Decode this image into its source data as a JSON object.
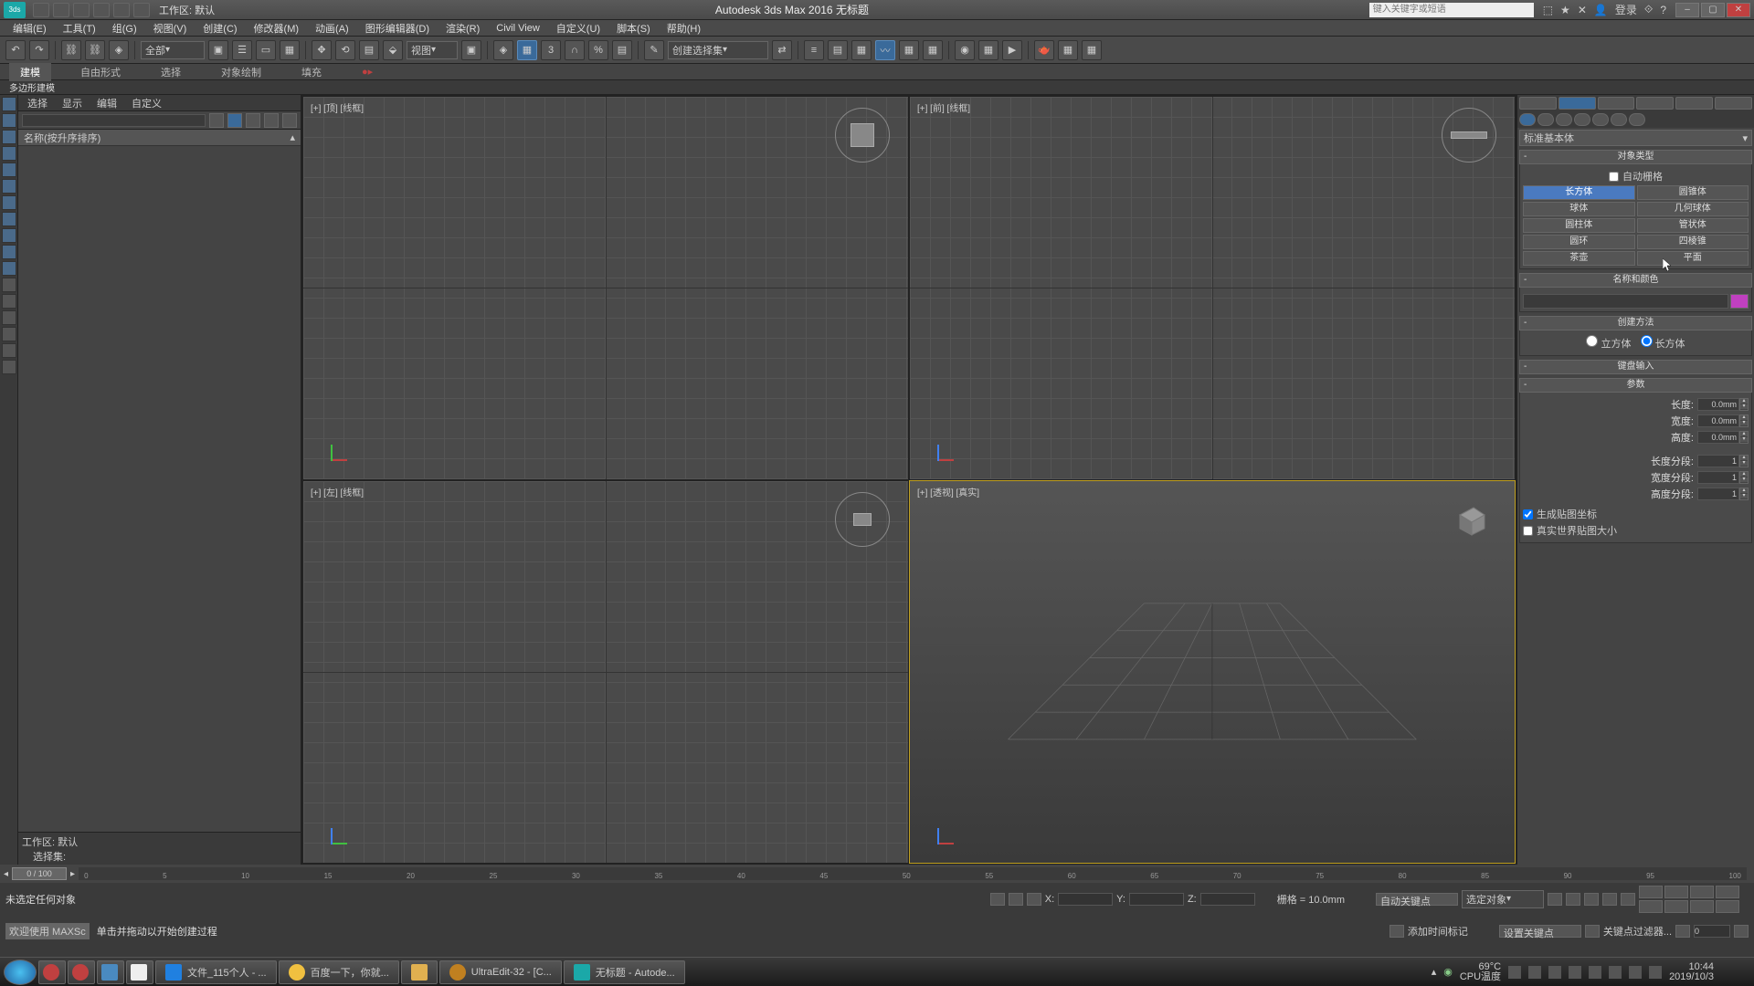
{
  "title": "Autodesk 3ds Max 2016   无标题",
  "workspace": "工作区: 默认",
  "search_placeholder": "键入关键字或短语",
  "login": "登录",
  "menus": [
    "编辑(E)",
    "工具(T)",
    "组(G)",
    "视图(V)",
    "创建(C)",
    "修改器(M)",
    "动画(A)",
    "图形编辑器(D)",
    "渲染(R)",
    "Civil View",
    "自定义(U)",
    "脚本(S)",
    "帮助(H)"
  ],
  "toolbar_all": "全部",
  "toolbar_view": "视图",
  "toolbar_create_sel": "创建选择集",
  "ribbon": {
    "tabs": [
      "建模",
      "自由形式",
      "选择",
      "对象绘制",
      "填充"
    ],
    "sub": "多边形建模"
  },
  "scene_tabs": [
    "选择",
    "显示",
    "编辑",
    "自定义"
  ],
  "scene_header": "名称(按升序排序)",
  "scene_ws": "工作区: 默认",
  "scene_set": "选择集:",
  "viewports": {
    "tl": "[+] [顶] [线框]",
    "tr": "[+] [前] [线框]",
    "bl": "[+] [左] [线框]",
    "br": "[+] [透视] [真实]"
  },
  "cmd": {
    "dropdown": "标准基本体",
    "rollout_objtype": "对象类型",
    "autogrid": "自动栅格",
    "objects": [
      "长方体",
      "圆锥体",
      "球体",
      "几何球体",
      "圆柱体",
      "管状体",
      "圆环",
      "四棱锥",
      "茶壶",
      "平面"
    ],
    "rollout_name": "名称和颜色",
    "rollout_method": "创建方法",
    "radio1": "立方体",
    "radio2": "长方体",
    "rollout_kbd": "键盘输入",
    "rollout_params": "参数",
    "p_length": "长度:",
    "p_width": "宽度:",
    "p_height": "高度:",
    "p_lseg": "长度分段:",
    "p_wseg": "宽度分段:",
    "p_hseg": "高度分段:",
    "v_dim": "0.0mm",
    "v_seg": "1",
    "chk_uv": "生成贴图坐标",
    "chk_real": "真实世界贴图大小"
  },
  "timeline": {
    "slider": "0 / 100",
    "ticks": [
      "0",
      "5",
      "10",
      "15",
      "20",
      "25",
      "30",
      "35",
      "40",
      "45",
      "50",
      "55",
      "60",
      "65",
      "70",
      "75",
      "80",
      "85",
      "90",
      "95",
      "100"
    ]
  },
  "status": {
    "none_selected": "未选定任何对象",
    "welcome": "欢迎使用 MAXSc",
    "hint": "单击并拖动以开始创建过程",
    "grid": "栅格 = 10.0mm",
    "add_marker": "添加时间标记",
    "x": "X:",
    "y": "Y:",
    "z": "Z:",
    "autokey": "自动关键点",
    "setkey": "设置关键点",
    "selobj": "选定对象",
    "keyfilter": "关键点过滤器..."
  },
  "taskbar": {
    "items": [
      "文件_115个人 - ...",
      "百度一下，你就...",
      "",
      "UltraEdit-32 - [C...",
      "无标题 - Autode..."
    ],
    "temp": "69°C",
    "cpu": "CPU温度",
    "time": "10:44",
    "date": "2019/10/3"
  }
}
